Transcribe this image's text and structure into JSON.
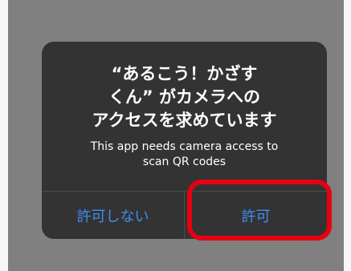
{
  "dialog": {
    "title": "“あるこう！かざす\nくん” がカメラへの\nアクセスを求めています",
    "message": "This app needs camera access to\nscan QR codes",
    "deny_label": "許可しない",
    "allow_label": "許可"
  },
  "colors": {
    "dialog_bg": "#333333",
    "button_text": "#3f8ef3",
    "highlight": "#e60012",
    "screen_bg": "#808080"
  }
}
